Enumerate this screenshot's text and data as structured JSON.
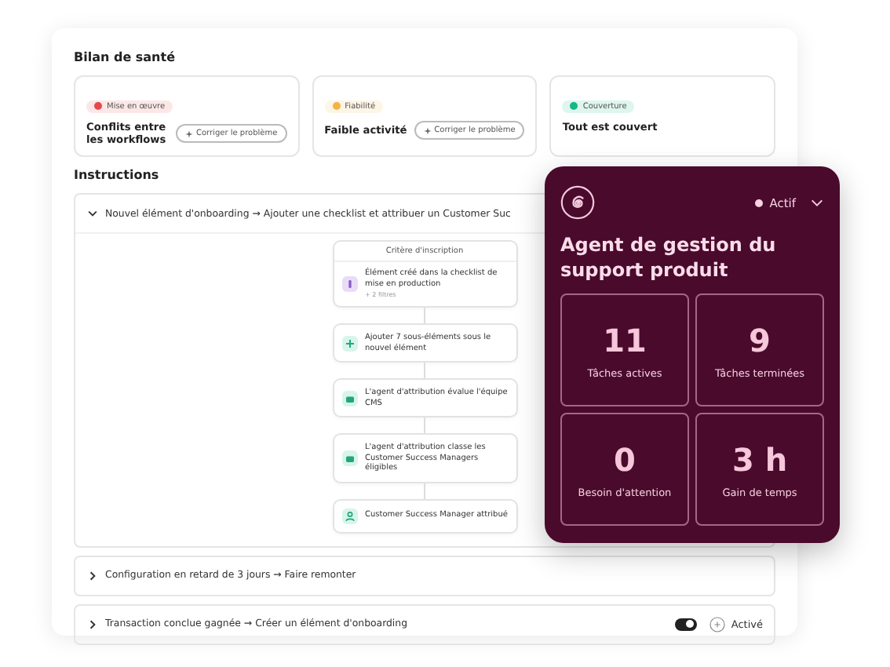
{
  "health": {
    "title": "Bilan de santé",
    "cards": [
      {
        "tag": "Mise en œuvre",
        "color": "#e5484d",
        "title": "Conflits entre les workflows",
        "action": "Corriger le problème"
      },
      {
        "tag": "Fiabilité",
        "color": "#f2b544",
        "title": "Faible activité",
        "action": "Corriger le problème"
      },
      {
        "tag": "Couverture",
        "color": "#12b886",
        "title": "Tout est couvert"
      }
    ]
  },
  "instructions": {
    "title": "Instructions",
    "rules": [
      {
        "label": "Nouvel élément d'onboarding → Ajouter une checklist et attribuer un Customer Suc",
        "expanded": true,
        "trigger": "Critère d'inscription",
        "steps": [
          {
            "kind": "trigger",
            "text": "Élément créé dans la checklist de mise en production",
            "note": "+ 2 filtres"
          },
          {
            "kind": "add",
            "text": "Ajouter 7 sous-éléments sous le nouvel élément"
          },
          {
            "kind": "agent",
            "text": "L'agent d'attribution évalue l'équipe CMS"
          },
          {
            "kind": "agent",
            "text": "L'agent d'attribution classe les Customer Success Managers éligibles"
          },
          {
            "kind": "person",
            "text": "Customer Success Manager attribué"
          }
        ]
      },
      {
        "label": "Configuration en retard de 3 jours → Faire remonter",
        "expanded": false
      },
      {
        "label": "Transaction conclue gagnée → Créer un élément d'onboarding",
        "expanded": false,
        "toggle": {
          "on": true
        },
        "status": "Activé"
      }
    ]
  },
  "agent": {
    "status": "Actif",
    "title": "Agent de gestion du support produit",
    "stats": [
      {
        "value": "11",
        "label": "Tâches actives"
      },
      {
        "value": "9",
        "label": "Tâches terminées"
      },
      {
        "value": "0",
        "label": "Besoin d'attention"
      },
      {
        "value": "3 h",
        "label": "Gain de temps"
      }
    ]
  }
}
